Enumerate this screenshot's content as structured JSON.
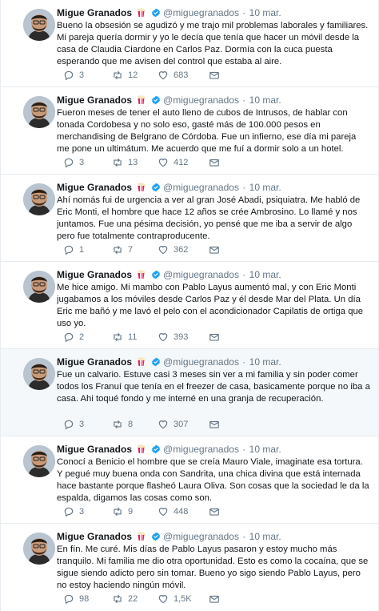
{
  "author": {
    "name": "Migue Granados",
    "handle": "@miguegranados",
    "badge_icon": "popcorn-icon",
    "verified_icon": "verified-badge-icon",
    "verified_color": "#1da1f2"
  },
  "tweets": [
    {
      "time": "10 mar.",
      "text": "Bueno la obsesión se agudizó y me trajo mil problemas laborales y familiares. Mi pareja quería dormir y yo le decía que tenía que hacer un móvil desde la casa de Claudia Ciardone en Carlos Paz. Dormía con la cuca puesta esperando que me avisen del control que estaba al aire.",
      "replies": "3",
      "retweets": "12",
      "likes": "683",
      "highlighted": false
    },
    {
      "time": "10 mar.",
      "text": "Fueron meses de tener el auto lleno de cubos de Intrusos, de hablar con tonada Cordobesa y no solo eso, gasté más de 100.000 pesos en merchandising de Belgrano de Córdoba.  Fue un infierno, ese día mi pareja me pone un ultimátum. Me acuerdo que me fuí a dormir solo a un hotel.",
      "replies": "3",
      "retweets": "13",
      "likes": "412",
      "highlighted": false
    },
    {
      "time": "10 mar.",
      "text": "Ahí nomás fui de urgencia a ver al gran José Abadi, psiquiatra. Me habló de Eric Monti, el hombre que hace 12 años se crée Ambrosino. Lo llamé y nos juntamos. Fue una pésima decisión, yo pensé que me iba a servir de algo pero fue totalmente contraproducente.",
      "replies": "1",
      "retweets": "7",
      "likes": "362",
      "highlighted": false
    },
    {
      "time": "10 mar.",
      "text": "Me hice amigo. Mi mambo con Pablo Layus aumentó mal, y con Eric Monti jugabamos a los móviles desde Carlos Paz y él desde Mar del Plata. Un día Eric me bañó y me lavó el pelo con el acondicionador Capilatis de ortiga que uso yo.",
      "replies": "2",
      "retweets": "11",
      "likes": "393",
      "highlighted": false
    },
    {
      "time": "10 mar.",
      "text": "Fue un calvario. Estuve casi 3 meses sin ver a mi familia y sin poder comer todos los Franuí que tenía en el freezer de casa, basicamente porque no iba a casa. Ahi toqué fondo y me interné en una granja de recuperación.",
      "replies": "3",
      "retweets": "8",
      "likes": "307",
      "highlighted": true
    },
    {
      "time": "10 mar.",
      "text": "Conocí a Benicio el hombre que se creía Mauro Viale, imaginate esa tortura. Y pegué muy buena onda con Sandrita, una chica divina que está internada hace bastante porque flasheó Laura Oliva. Son cosas que la sociedad le da la espalda, digamos las cosas como son.",
      "replies": "3",
      "retweets": "9",
      "likes": "448",
      "highlighted": false
    },
    {
      "time": "10 mar.",
      "text": "En fín. Me curé. Mis días de Pablo Layus pasaron y estoy mucho más tranquilo. Mi familia me dio otra oportunidad. Esto es como la cocaína, que se sigue siendo adicto pero sin tomar. Bueno yo sigo siendo Pablo Layus, pero no estoy haciendo ningún móvil.",
      "replies": "98",
      "retweets": "22",
      "likes": "1,5K",
      "highlighted": false
    }
  ]
}
